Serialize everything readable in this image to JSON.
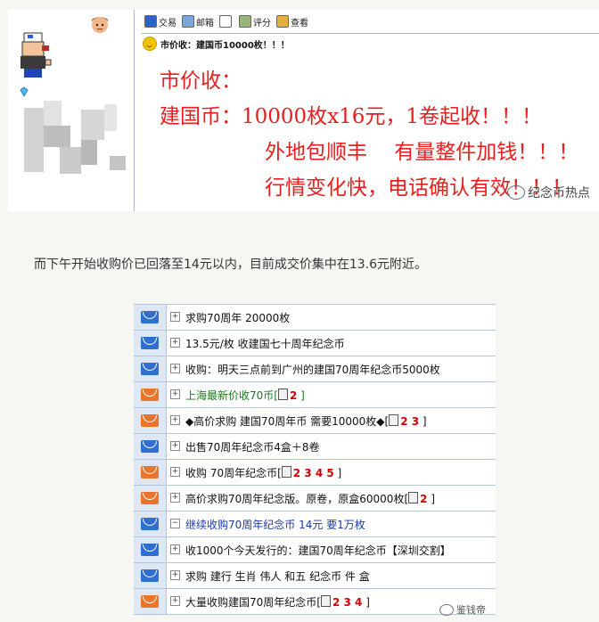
{
  "post": {
    "toolbar": [
      {
        "label": "交易",
        "icon": "shield-icon"
      },
      {
        "label": "邮箱",
        "icon": "mail-icon"
      },
      {
        "label": "",
        "icon": "square-icon"
      },
      {
        "label": "评分",
        "icon": "rating-icon"
      },
      {
        "label": "查看",
        "icon": "view-icon"
      }
    ],
    "title": "市价收：建国币10000枚！！！",
    "body": {
      "line1": "市价收：",
      "line2": "建国币：10000枚x16元，1卷起收！！！",
      "line3": "外地包顺丰　 有量整件加钱！！！",
      "line4": "行情变化快，电话确认有效！！！"
    },
    "watermark": "纪念币热点",
    "colors": {
      "accent": "#e62020",
      "border": "#a8b8cc"
    }
  },
  "middle_text": "而下午开始收购价已回落至14元以内，目前成交价集中在13.6元附近。",
  "threads": [
    {
      "icon": "blue",
      "toggle": "+",
      "title": "求购70周年 20000枚",
      "style": "normal",
      "pages": ""
    },
    {
      "icon": "blue",
      "toggle": "+",
      "title": "13.5元/枚 收建国七十周年纪念币",
      "style": "normal",
      "pages": ""
    },
    {
      "icon": "blue",
      "toggle": "+",
      "title": "收购：明天三点前到广州的建国70周年纪念币5000枚",
      "style": "normal",
      "pages": ""
    },
    {
      "icon": "orange",
      "toggle": "+",
      "title": "上海最新价收70币",
      "style": "green",
      "pages": "2"
    },
    {
      "icon": "orange",
      "toggle": "+",
      "title": "◆高价求购 建国70周年币 需要10000枚◆",
      "style": "normal",
      "pages": "2 3"
    },
    {
      "icon": "blue",
      "toggle": "+",
      "title": "出售70周年纪念币4盒＋8卷",
      "style": "normal",
      "pages": ""
    },
    {
      "icon": "orange",
      "toggle": "+",
      "title": "收购 70周年纪念币",
      "style": "normal",
      "pages": "2 3 4 5"
    },
    {
      "icon": "orange",
      "toggle": "+",
      "title": "高价求购70周年纪念版。原卷，原盒60000枚",
      "style": "normal",
      "pages": "2"
    },
    {
      "icon": "blue",
      "toggle": "−",
      "title": "继续收购70周年纪念币 14元 要1万枚",
      "style": "blue",
      "pages": ""
    },
    {
      "icon": "blue",
      "toggle": "+",
      "title": "收1000个今天发行的：建国70周年纪念币【深圳交割】",
      "style": "normal",
      "pages": ""
    },
    {
      "icon": "blue",
      "toggle": "+",
      "title": "求购 建行 生肖 伟人 和五 纪念币 件 盒",
      "style": "normal",
      "pages": ""
    },
    {
      "icon": "orange",
      "toggle": "+",
      "title": "大量收购建国70周年纪念币",
      "style": "normal",
      "pages": "2 3 4"
    }
  ],
  "bottom_watermark": "鉴钱帝"
}
